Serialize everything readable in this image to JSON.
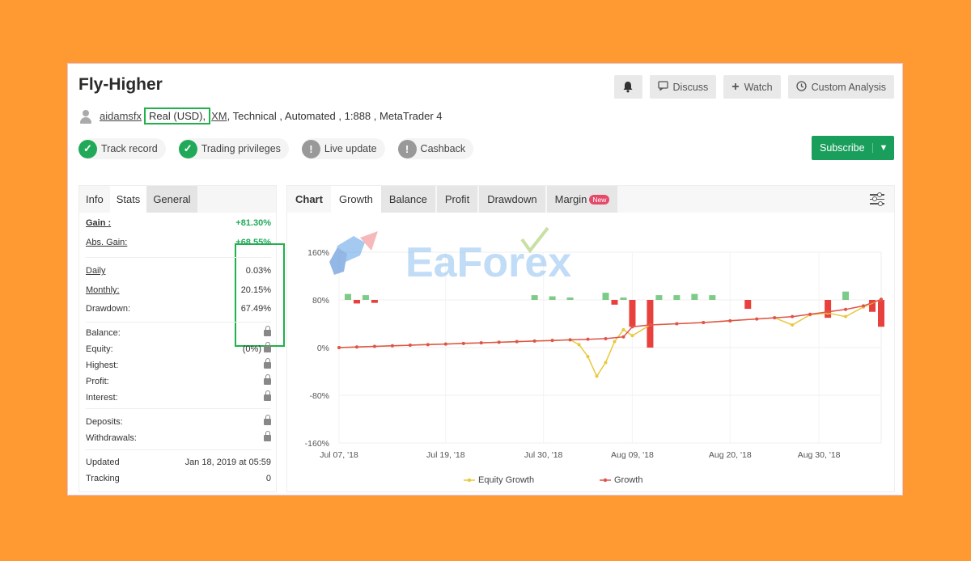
{
  "header": {
    "title": "Fly-Higher",
    "username": "aidamsfx",
    "account_type": "Real (USD),",
    "broker": "XM",
    "details": ", Technical , Automated , 1:888 , MetaTrader 4"
  },
  "actions": {
    "bell": "bell-icon",
    "discuss": "Discuss",
    "watch": "Watch",
    "custom_analysis": "Custom Analysis",
    "subscribe": "Subscribe"
  },
  "badges": [
    {
      "label": "Track record",
      "status": "verified"
    },
    {
      "label": "Trading privileges",
      "status": "verified"
    },
    {
      "label": "Live update",
      "status": "unavailable"
    },
    {
      "label": "Cashback",
      "status": "unavailable"
    }
  ],
  "left_tabs": [
    "Info",
    "Stats",
    "General"
  ],
  "stats": {
    "gain": {
      "label": "Gain :",
      "value": "+81.30%"
    },
    "abs_gain": {
      "label": "Abs. Gain:",
      "value": "+68.55%"
    },
    "daily": {
      "label": "Daily",
      "value": "0.03%"
    },
    "monthly": {
      "label": "Monthly:",
      "value": "20.15%"
    },
    "drawdown": {
      "label": "Drawdown:",
      "value": "67.49%"
    },
    "balance": {
      "label": "Balance:"
    },
    "equity": {
      "label": "Equity:",
      "value": "(0%)"
    },
    "highest": {
      "label": "Highest:"
    },
    "profit": {
      "label": "Profit:"
    },
    "interest": {
      "label": "Interest:"
    },
    "deposits": {
      "label": "Deposits:"
    },
    "withdrawals": {
      "label": "Withdrawals:"
    },
    "updated": {
      "label": "Updated",
      "value": "Jan 18, 2019 at 05:59"
    },
    "tracking": {
      "label": "Tracking",
      "value": "0"
    }
  },
  "right_tabs": {
    "chart": "Chart",
    "growth": "Growth",
    "balance": "Balance",
    "profit": "Profit",
    "drawdown": "Drawdown",
    "margin": "Margin",
    "new_badge": "New"
  },
  "watermark": "EaForex",
  "colors": {
    "background": "#FF9A32",
    "subscribe": "#1A9E5C",
    "verified": "#21A95A",
    "highlight_box": "#1FB14A",
    "growth_line": "#E0534A",
    "equity_line": "#E8C83C",
    "bar_positive": "#7DCB88",
    "bar_negative": "#E8413D"
  },
  "chart_data": {
    "type": "line",
    "ylim": [
      -160,
      160
    ],
    "yticks": [
      "160%",
      "80%",
      "0%",
      "-80%",
      "-160%"
    ],
    "xticks": [
      "Jul 07, '18",
      "Jul 19, '18",
      "Jul 30, '18",
      "Aug 09, '18",
      "Aug 20, '18",
      "Aug 30, '18"
    ],
    "x_start": "2018-07-07",
    "x_end": "2018-09-06",
    "legend": "bottom",
    "series": [
      {
        "name": "Equity Growth",
        "points": [
          [
            "2018-07-07",
            0
          ],
          [
            "2018-07-09",
            1
          ],
          [
            "2018-07-11",
            2
          ],
          [
            "2018-07-13",
            3
          ],
          [
            "2018-07-15",
            4
          ],
          [
            "2018-07-17",
            5
          ],
          [
            "2018-07-19",
            6
          ],
          [
            "2018-07-21",
            7
          ],
          [
            "2018-07-23",
            8
          ],
          [
            "2018-07-25",
            9
          ],
          [
            "2018-07-27",
            10
          ],
          [
            "2018-07-29",
            11
          ],
          [
            "2018-07-31",
            12
          ],
          [
            "2018-08-02",
            13
          ],
          [
            "2018-08-03",
            5
          ],
          [
            "2018-08-04",
            -15
          ],
          [
            "2018-08-05",
            -48
          ],
          [
            "2018-08-06",
            -25
          ],
          [
            "2018-08-07",
            10
          ],
          [
            "2018-08-08",
            30
          ],
          [
            "2018-08-09",
            20
          ],
          [
            "2018-08-11",
            38
          ],
          [
            "2018-08-14",
            40
          ],
          [
            "2018-08-17",
            42
          ],
          [
            "2018-08-20",
            45
          ],
          [
            "2018-08-23",
            48
          ],
          [
            "2018-08-25",
            50
          ],
          [
            "2018-08-27",
            38
          ],
          [
            "2018-08-29",
            55
          ],
          [
            "2018-08-31",
            58
          ],
          [
            "2018-09-02",
            52
          ],
          [
            "2018-09-04",
            68
          ],
          [
            "2018-09-06",
            81
          ]
        ]
      },
      {
        "name": "Growth",
        "points": [
          [
            "2018-07-07",
            0
          ],
          [
            "2018-07-09",
            1
          ],
          [
            "2018-07-11",
            2
          ],
          [
            "2018-07-13",
            3
          ],
          [
            "2018-07-15",
            4
          ],
          [
            "2018-07-17",
            5
          ],
          [
            "2018-07-19",
            6
          ],
          [
            "2018-07-21",
            7
          ],
          [
            "2018-07-23",
            8
          ],
          [
            "2018-07-25",
            9
          ],
          [
            "2018-07-27",
            10
          ],
          [
            "2018-07-29",
            11
          ],
          [
            "2018-07-31",
            12
          ],
          [
            "2018-08-02",
            13
          ],
          [
            "2018-08-04",
            14
          ],
          [
            "2018-08-06",
            15
          ],
          [
            "2018-08-08",
            18
          ],
          [
            "2018-08-09",
            35
          ],
          [
            "2018-08-11",
            38
          ],
          [
            "2018-08-14",
            40
          ],
          [
            "2018-08-17",
            42
          ],
          [
            "2018-08-20",
            45
          ],
          [
            "2018-08-23",
            48
          ],
          [
            "2018-08-25",
            50
          ],
          [
            "2018-08-27",
            52
          ],
          [
            "2018-08-29",
            56
          ],
          [
            "2018-08-31",
            60
          ],
          [
            "2018-09-02",
            64
          ],
          [
            "2018-09-04",
            70
          ],
          [
            "2018-09-06",
            81
          ]
        ]
      }
    ],
    "bars": [
      [
        "2018-07-08",
        10
      ],
      [
        "2018-07-09",
        -6
      ],
      [
        "2018-07-10",
        8
      ],
      [
        "2018-07-11",
        -5
      ],
      [
        "2018-07-29",
        8
      ],
      [
        "2018-07-31",
        6
      ],
      [
        "2018-08-02",
        4
      ],
      [
        "2018-08-06",
        12
      ],
      [
        "2018-08-07",
        -8
      ],
      [
        "2018-08-08",
        4
      ],
      [
        "2018-08-09",
        -45
      ],
      [
        "2018-08-11",
        -80
      ],
      [
        "2018-08-12",
        8
      ],
      [
        "2018-08-14",
        8
      ],
      [
        "2018-08-16",
        10
      ],
      [
        "2018-08-18",
        8
      ],
      [
        "2018-08-22",
        -15
      ],
      [
        "2018-08-31",
        -30
      ],
      [
        "2018-09-02",
        14
      ],
      [
        "2018-09-05",
        -20
      ],
      [
        "2018-09-06",
        -45
      ]
    ]
  }
}
